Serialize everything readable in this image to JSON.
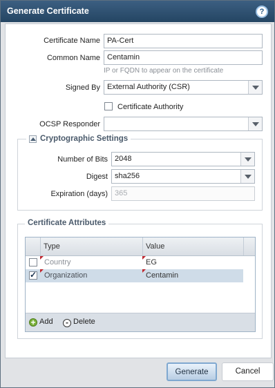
{
  "dialog": {
    "title": "Generate Certificate",
    "help": "?"
  },
  "form": {
    "cert_name": {
      "label": "Certificate Name",
      "value": "PA-Cert"
    },
    "common_name": {
      "label": "Common Name",
      "value": "Centamin",
      "hint": "IP or FQDN to appear on the certificate"
    },
    "signed_by": {
      "label": "Signed By",
      "value": "External Authority (CSR)"
    },
    "cert_authority": {
      "label": "Certificate Authority",
      "checked": false
    },
    "ocsp": {
      "label": "OCSP Responder",
      "value": ""
    }
  },
  "crypto": {
    "legend": "Cryptographic Settings",
    "bits": {
      "label": "Number of Bits",
      "value": "2048"
    },
    "digest": {
      "label": "Digest",
      "value": "sha256"
    },
    "expiration": {
      "label": "Expiration (days)",
      "placeholder": "365"
    }
  },
  "attributes": {
    "legend": "Certificate Attributes",
    "columns": [
      "Type",
      "Value"
    ],
    "rows": [
      {
        "type": "Country",
        "value": "EG",
        "checked": false
      },
      {
        "type": "Organization",
        "value": "Centamin",
        "checked": true
      }
    ],
    "add_label": "Add",
    "delete_label": "Delete"
  },
  "buttons": {
    "generate": "Generate",
    "cancel": "Cancel"
  },
  "colors": {
    "titlebar": "#2b4c6d",
    "accent": "#7fa8d0",
    "row_selected": "#cfdce8"
  }
}
